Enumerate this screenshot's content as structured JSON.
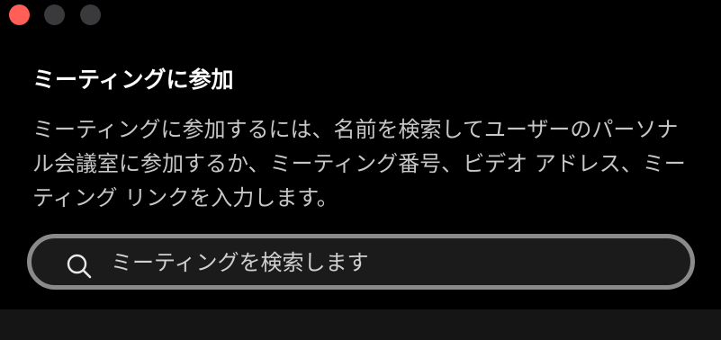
{
  "window": {
    "controls": [
      "close",
      "minimize",
      "maximize"
    ],
    "control_colors": {
      "close": "#ff5f57",
      "inactive": "#3a3a3c"
    }
  },
  "dialog": {
    "title": "ミーティングに参加",
    "description": "ミーティングに参加するには、名前を検索してユーザーのパーソナル会議室に参加するか、ミーティング番号、ビデオ アドレス、ミーティング リンクを入力します。"
  },
  "search": {
    "placeholder": "ミーティングを検索します",
    "value": "",
    "icon": "search-icon"
  },
  "colors": {
    "background": "#000000",
    "title": "#ffffff",
    "text": "#c7c7c7",
    "search_border": "#8a8a8a",
    "search_bg": "#1b1b1b"
  }
}
